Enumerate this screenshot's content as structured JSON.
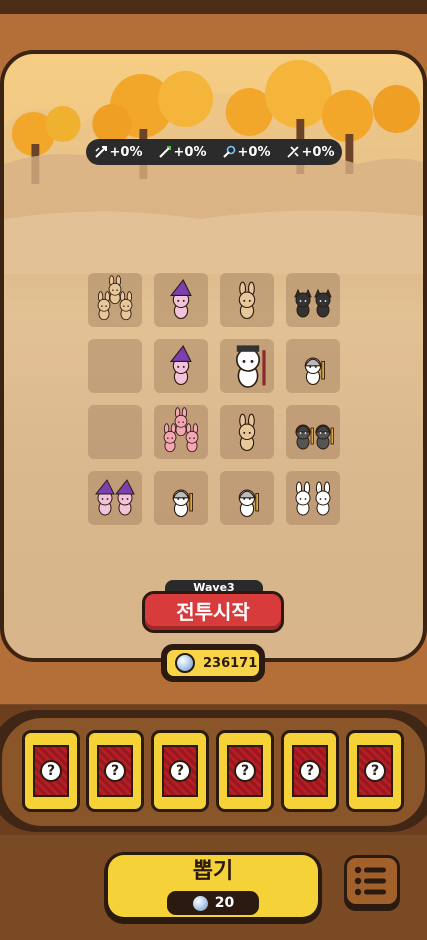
{
  "stats": [
    {
      "icon": "attack-speed-icon",
      "value": "+0%"
    },
    {
      "icon": "damage-icon",
      "value": "+0%"
    },
    {
      "icon": "magic-icon",
      "value": "+0%"
    },
    {
      "icon": "crit-icon",
      "value": "+0%"
    }
  ],
  "wave_label": "Wave3",
  "battle_button": "전투시작",
  "gem_count": "236171",
  "draw_button": "뽑기",
  "draw_cost": "20",
  "card_symbol": "?",
  "colors": {
    "battle": "#d83b3b",
    "gold": "#f6d239",
    "card_face": "#b81d24",
    "frame": "#b36f37"
  },
  "units": [
    {
      "row": 0,
      "col": 0,
      "type": "bunny-archer",
      "count": 3,
      "tint": "#e8c79a"
    },
    {
      "row": 0,
      "col": 1,
      "type": "witch",
      "count": 1,
      "tint": "#f2c4dc"
    },
    {
      "row": 0,
      "col": 2,
      "type": "bunny-archer",
      "count": 1,
      "tint": "#e8c79a"
    },
    {
      "row": 0,
      "col": 3,
      "type": "black-cat",
      "count": 2,
      "tint": "#333333"
    },
    {
      "row": 1,
      "col": 0,
      "type": "empty",
      "count": 0,
      "tint": ""
    },
    {
      "row": 1,
      "col": 1,
      "type": "witch",
      "count": 1,
      "tint": "#f2c4dc"
    },
    {
      "row": 1,
      "col": 2,
      "type": "maid-mage",
      "count": 1,
      "tint": "#ffffff"
    },
    {
      "row": 1,
      "col": 3,
      "type": "knight",
      "count": 1,
      "tint": "#ffffff"
    },
    {
      "row": 2,
      "col": 0,
      "type": "empty",
      "count": 0,
      "tint": ""
    },
    {
      "row": 2,
      "col": 1,
      "type": "pink-bunny",
      "count": 3,
      "tint": "#f4a6b5"
    },
    {
      "row": 2,
      "col": 2,
      "type": "bunny-archer",
      "count": 1,
      "tint": "#e8c79a"
    },
    {
      "row": 2,
      "col": 3,
      "type": "dark-knight",
      "count": 2,
      "tint": "#555555"
    },
    {
      "row": 3,
      "col": 0,
      "type": "witch",
      "count": 2,
      "tint": "#f2c4dc"
    },
    {
      "row": 3,
      "col": 1,
      "type": "knight",
      "count": 1,
      "tint": "#ffffff"
    },
    {
      "row": 3,
      "col": 2,
      "type": "knight",
      "count": 1,
      "tint": "#ffffff"
    },
    {
      "row": 3,
      "col": 3,
      "type": "white-bunny",
      "count": 2,
      "tint": "#ffffff"
    }
  ]
}
